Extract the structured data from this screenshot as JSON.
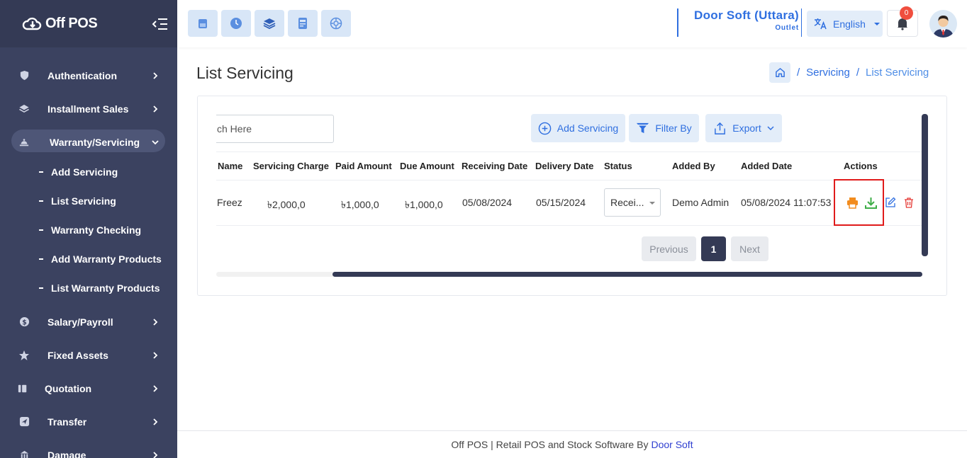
{
  "brand": {
    "name": "Off POS"
  },
  "sidebar": {
    "items": [
      {
        "label": "Authentication",
        "icon": "shield-icon"
      },
      {
        "label": "Installment Sales",
        "icon": "layers-icon"
      },
      {
        "label": "Warranty/Servicing",
        "icon": "service-icon",
        "expanded": true
      },
      {
        "label": "Salary/Payroll",
        "icon": "dollar-icon"
      },
      {
        "label": "Fixed Assets",
        "icon": "star-icon"
      },
      {
        "label": "Quotation",
        "icon": "quote-icon"
      },
      {
        "label": "Transfer",
        "icon": "send-icon"
      },
      {
        "label": "Damage",
        "icon": "damage-icon"
      }
    ],
    "submenu": [
      {
        "label": "Add Servicing"
      },
      {
        "label": "List Servicing"
      },
      {
        "label": "Warranty Checking"
      },
      {
        "label": "Add Warranty Products"
      },
      {
        "label": "List Warranty Products"
      }
    ]
  },
  "topbar": {
    "quick_buttons": [
      "pos-icon",
      "clock-icon",
      "stack-icon",
      "calculator-icon",
      "dashboard-icon"
    ],
    "outlet_name": "Door Soft (Uttara)",
    "outlet_type": "Outlet",
    "language": "English",
    "notification_count": "0"
  },
  "page": {
    "title": "List Servicing",
    "breadcrumb": [
      "Servicing",
      "List Servicing"
    ],
    "breadcrumb_sep": "/"
  },
  "toolbar": {
    "search_value": "ch Here",
    "add_label": "Add Servicing",
    "filter_label": "Filter By",
    "export_label": "Export"
  },
  "table": {
    "columns": [
      "Name",
      "Servicing Charge",
      "Paid Amount",
      "Due Amount",
      "Receiving Date",
      "Delivery Date",
      "Status",
      "Added By",
      "Added Date",
      "Actions"
    ],
    "rows": [
      {
        "name": "Freez",
        "servicing_charge": "৳2,000,0",
        "paid_amount": "৳1,000,0",
        "due_amount": "৳1,000,0",
        "receiving_date": "05/08/2024",
        "delivery_date": "05/15/2024",
        "status": "Recei...",
        "added_by": "Demo Admin",
        "added_date": "05/08/2024 11:07:53"
      }
    ]
  },
  "pagination": {
    "previous": "Previous",
    "current": "1",
    "next": "Next"
  },
  "footer": {
    "text": "Off POS | Retail POS and Stock Software By",
    "link": "Door Soft"
  },
  "colors": {
    "sidebar": "#3b4260",
    "accent": "#2f6fe0",
    "print": "#f28c1e",
    "download": "#3fae49",
    "delete": "#e53935",
    "highlight": "#e01b1b"
  }
}
